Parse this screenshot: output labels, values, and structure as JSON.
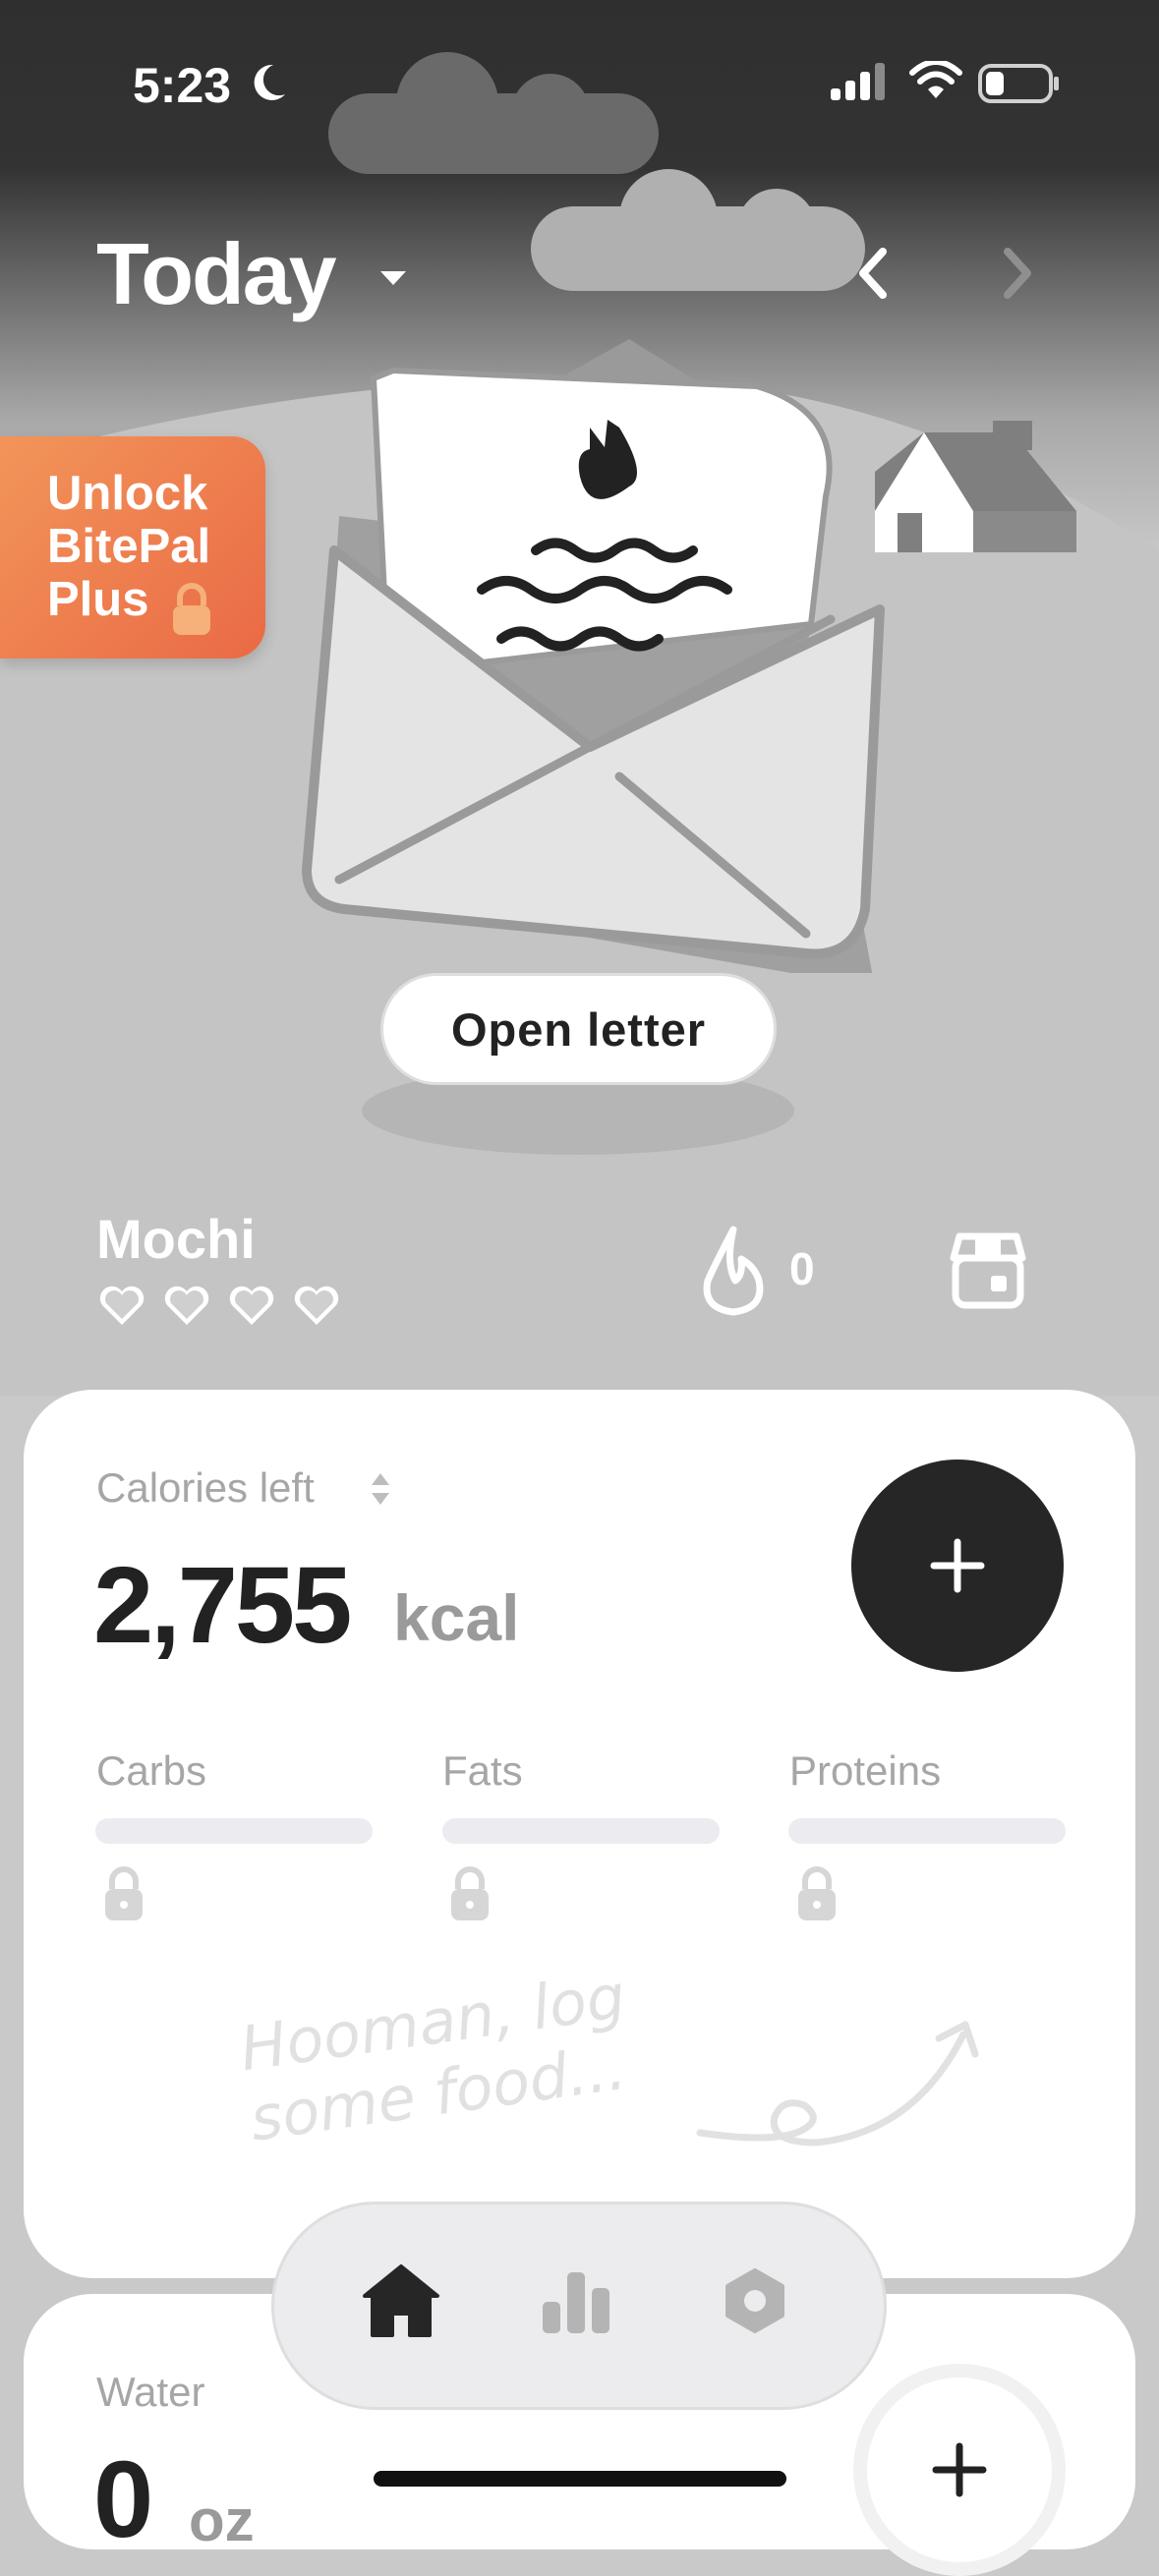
{
  "status_bar": {
    "time": "5:23"
  },
  "header": {
    "title": "Today"
  },
  "promo": {
    "line1": "Unlock",
    "line2": "BitePal",
    "line3": "Plus"
  },
  "letter": {
    "open_label": "Open letter"
  },
  "pet": {
    "name": "Mochi",
    "hearts": 4,
    "streak": "0"
  },
  "calories": {
    "label": "Calories left",
    "value": "2,755",
    "unit": "kcal",
    "macros": [
      {
        "label": "Carbs"
      },
      {
        "label": "Fats"
      },
      {
        "label": "Proteins"
      }
    ],
    "hint_line1": "Hooman, log",
    "hint_line2": "some food..."
  },
  "water": {
    "label": "Water",
    "value": "0",
    "unit": "oz"
  },
  "icons": {
    "status": [
      "moon-icon",
      "cellular-signal-icon",
      "wifi-icon",
      "battery-icon"
    ],
    "tabs": [
      "home-icon",
      "stats-icon",
      "settings-icon"
    ]
  },
  "colors": {
    "promo": "#ea6a45",
    "accent_dark": "#262626",
    "card": "#ffffff"
  }
}
